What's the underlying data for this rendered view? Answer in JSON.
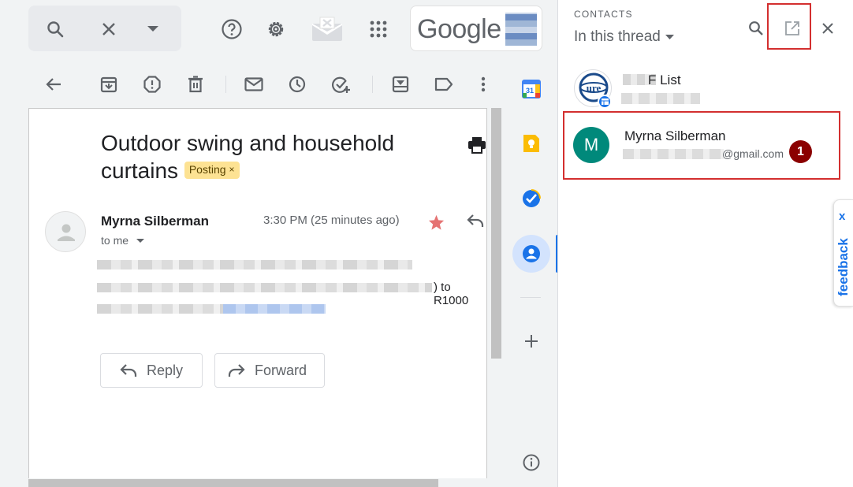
{
  "header": {
    "logo_text": "Google"
  },
  "icons": {
    "search": "search-icon",
    "close": "close-icon",
    "dropdown": "caret-down-icon",
    "help": "help-icon",
    "settings": "gear-icon",
    "apps": "apps-grid-icon"
  },
  "toolbar": {
    "icons": [
      "back-arrow-icon",
      "archive-icon",
      "report-spam-icon",
      "delete-icon",
      "mark-unread-icon",
      "snooze-icon",
      "add-task-icon",
      "move-to-icon",
      "label-icon",
      "more-vert-icon"
    ]
  },
  "message": {
    "subject": "Outdoor swing and household curtains",
    "label": "Posting",
    "label_remove": "×",
    "sender_name": "Myrna Silberman",
    "recipient": "to me",
    "time": "3:30 PM (25 minutes ago)",
    "body_visible_fragment": ") to R1000",
    "reply_label": "Reply",
    "forward_label": "Forward"
  },
  "side_rail": {
    "calendar_day": "31",
    "items": [
      "calendar-icon",
      "keep-icon",
      "tasks-icon",
      "contacts-icon",
      "add-icon",
      "info-icon"
    ]
  },
  "contacts_panel": {
    "title": "CONTACTS",
    "filter": "In this thread",
    "contacts": [
      {
        "name_visible": "F List"
      },
      {
        "name": "Myrna Silberman",
        "initial": "M",
        "email_visible": "@gmail.com",
        "badge": "1"
      }
    ]
  },
  "feedback": {
    "label": "feedback",
    "close": "x"
  },
  "colors": {
    "accent_blue": "#1a73e8",
    "avatar_teal": "#00897b",
    "label_yellow": "#fde293",
    "star": "#e57373",
    "highlight_red": "#d32f2f",
    "badge_red": "#8b0000"
  }
}
